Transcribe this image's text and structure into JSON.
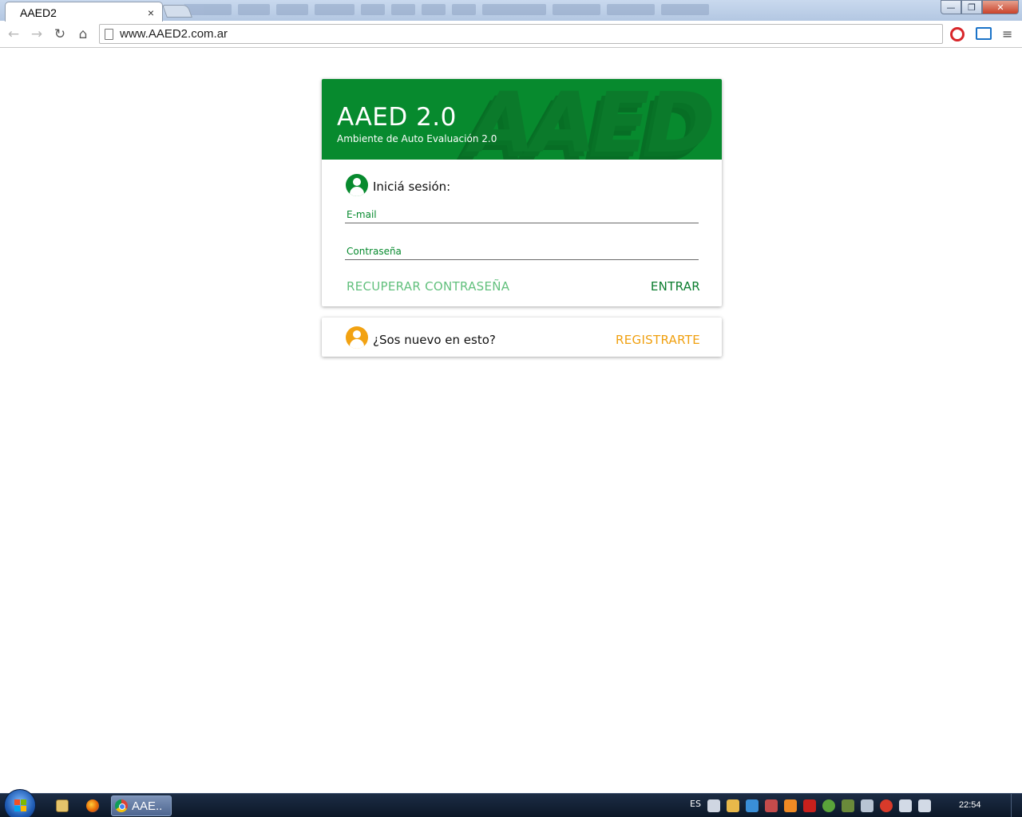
{
  "browser": {
    "tab_title": "AAED2",
    "tab_close": "×",
    "url": "www.AAED2.com.ar",
    "back_icon": "←",
    "forward_icon": "→",
    "reload_icon": "↻",
    "home_icon": "⌂",
    "menu_icon": "≡",
    "window_min": "—",
    "window_max": "❐",
    "window_close": "✕"
  },
  "login": {
    "app_title": "AAED 2.0",
    "app_subtitle": "Ambiente de Auto Evaluación 2.0",
    "watermark": "AAED",
    "signin_label": "Iniciá sesión:",
    "email_label": "E-mail",
    "password_label": "Contraseña",
    "recover_label": "RECUPERAR CONTRASEÑA",
    "enter_label": "ENTRAR"
  },
  "register": {
    "prompt": "¿Sos nuevo en esto?",
    "button_label": "REGISTRARTE"
  },
  "taskbar": {
    "active_task_label": "AAE..",
    "language": "ES",
    "clock": "22:54"
  },
  "colors": {
    "brand_green": "#078a2e",
    "link_light_green": "#62c07d",
    "register_orange": "#f0a010"
  }
}
